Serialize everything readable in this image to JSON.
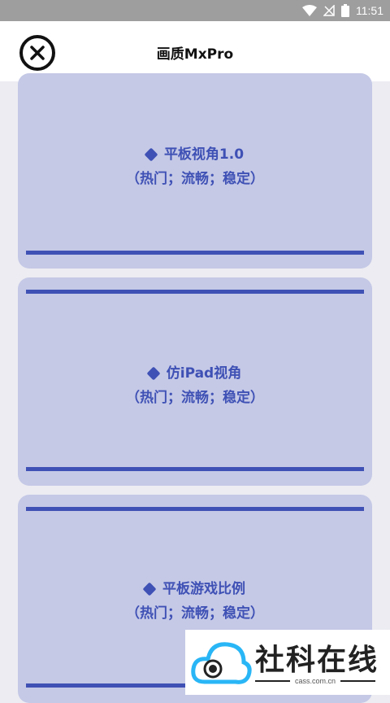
{
  "status_bar": {
    "time": "11:51"
  },
  "header": {
    "title": "画质MxPro"
  },
  "cards": [
    {
      "title": "平板视角1.0",
      "tags": "（热门；流畅；稳定）"
    },
    {
      "title": "仿iPad视角",
      "tags": "（热门；流畅；稳定）"
    },
    {
      "title": "平板游戏比例",
      "tags": "（热门；流畅；稳定）"
    }
  ],
  "watermark": {
    "text": "社科在线",
    "sub": "cass.com.cn"
  },
  "colors": {
    "accent": "#3f51b5",
    "card_bg": "#c5c9e6",
    "page_bg": "#ececf2"
  }
}
